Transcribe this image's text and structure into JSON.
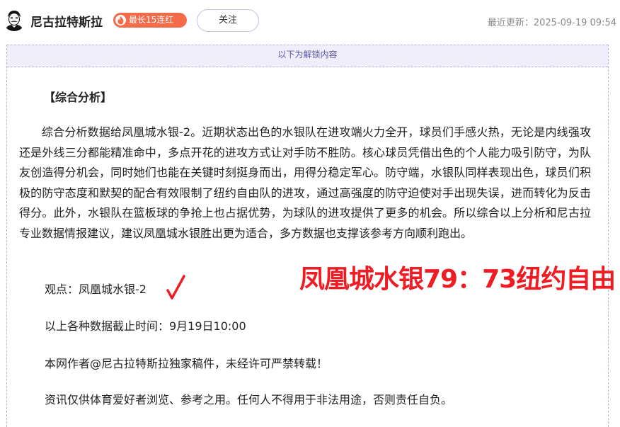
{
  "header": {
    "author_name": "尼古拉特斯拉",
    "streak_badge": "最长15连红",
    "follow_label": "关注",
    "update_time": "最近更新：2025-09-19 09:54"
  },
  "content": {
    "unlock_notice": "以下为解锁内容",
    "section_title": "【综合分析】",
    "analysis_text": "综合分析数据给凤凰城水银-2。近期状态出色的水银队在进攻端火力全开，球员们手感火热，无论是内线强攻还是外线三分都能精准命中，多点开花的进攻方式让对手防不胜防。核心球员凭借出色的个人能力吸引防守，为队友创造得分机会，同时她们也能在关键时刻挺身而出，用得分稳定军心。防守端，水银队同样表现出色，球员们积极的防守态度和默契的配合有效限制了纽约自由队的进攻，通过高强度的防守迫使对手出现失误，进而转化为反击得分。此外，水银队在篮板球的争抢上也占据优势，为球队的进攻提供了更多的机会。所以综合以上分析和尼古拉专业数据情报建议，建议凤凰城水银胜出更为适合，多方数据也支撑该参考方向顺利跑出。",
    "viewpoint": "观点：凤凰城水银-2",
    "check_mark": "√",
    "cutoff_time": "以上各种数据截止时间：9月19日10:00",
    "copyright": "本网作者@尼古拉特斯拉独家稿件，未经许可严禁转载！",
    "disclaimer": "资讯仅供体育爱好者浏览、参考之用。任何人不得用于非法用途，否则责任自负。"
  },
  "result_overlay": "凤凰城水银79：73纽约自由",
  "colors": {
    "accent_purple": "#5c55a6",
    "banner_bg": "#f0eefb",
    "badge_orange": "#f46b4a",
    "result_red": "#ef1d23"
  },
  "icons": {
    "avatar": "author-avatar-tesla-portrait",
    "badge": "fire-icon"
  }
}
